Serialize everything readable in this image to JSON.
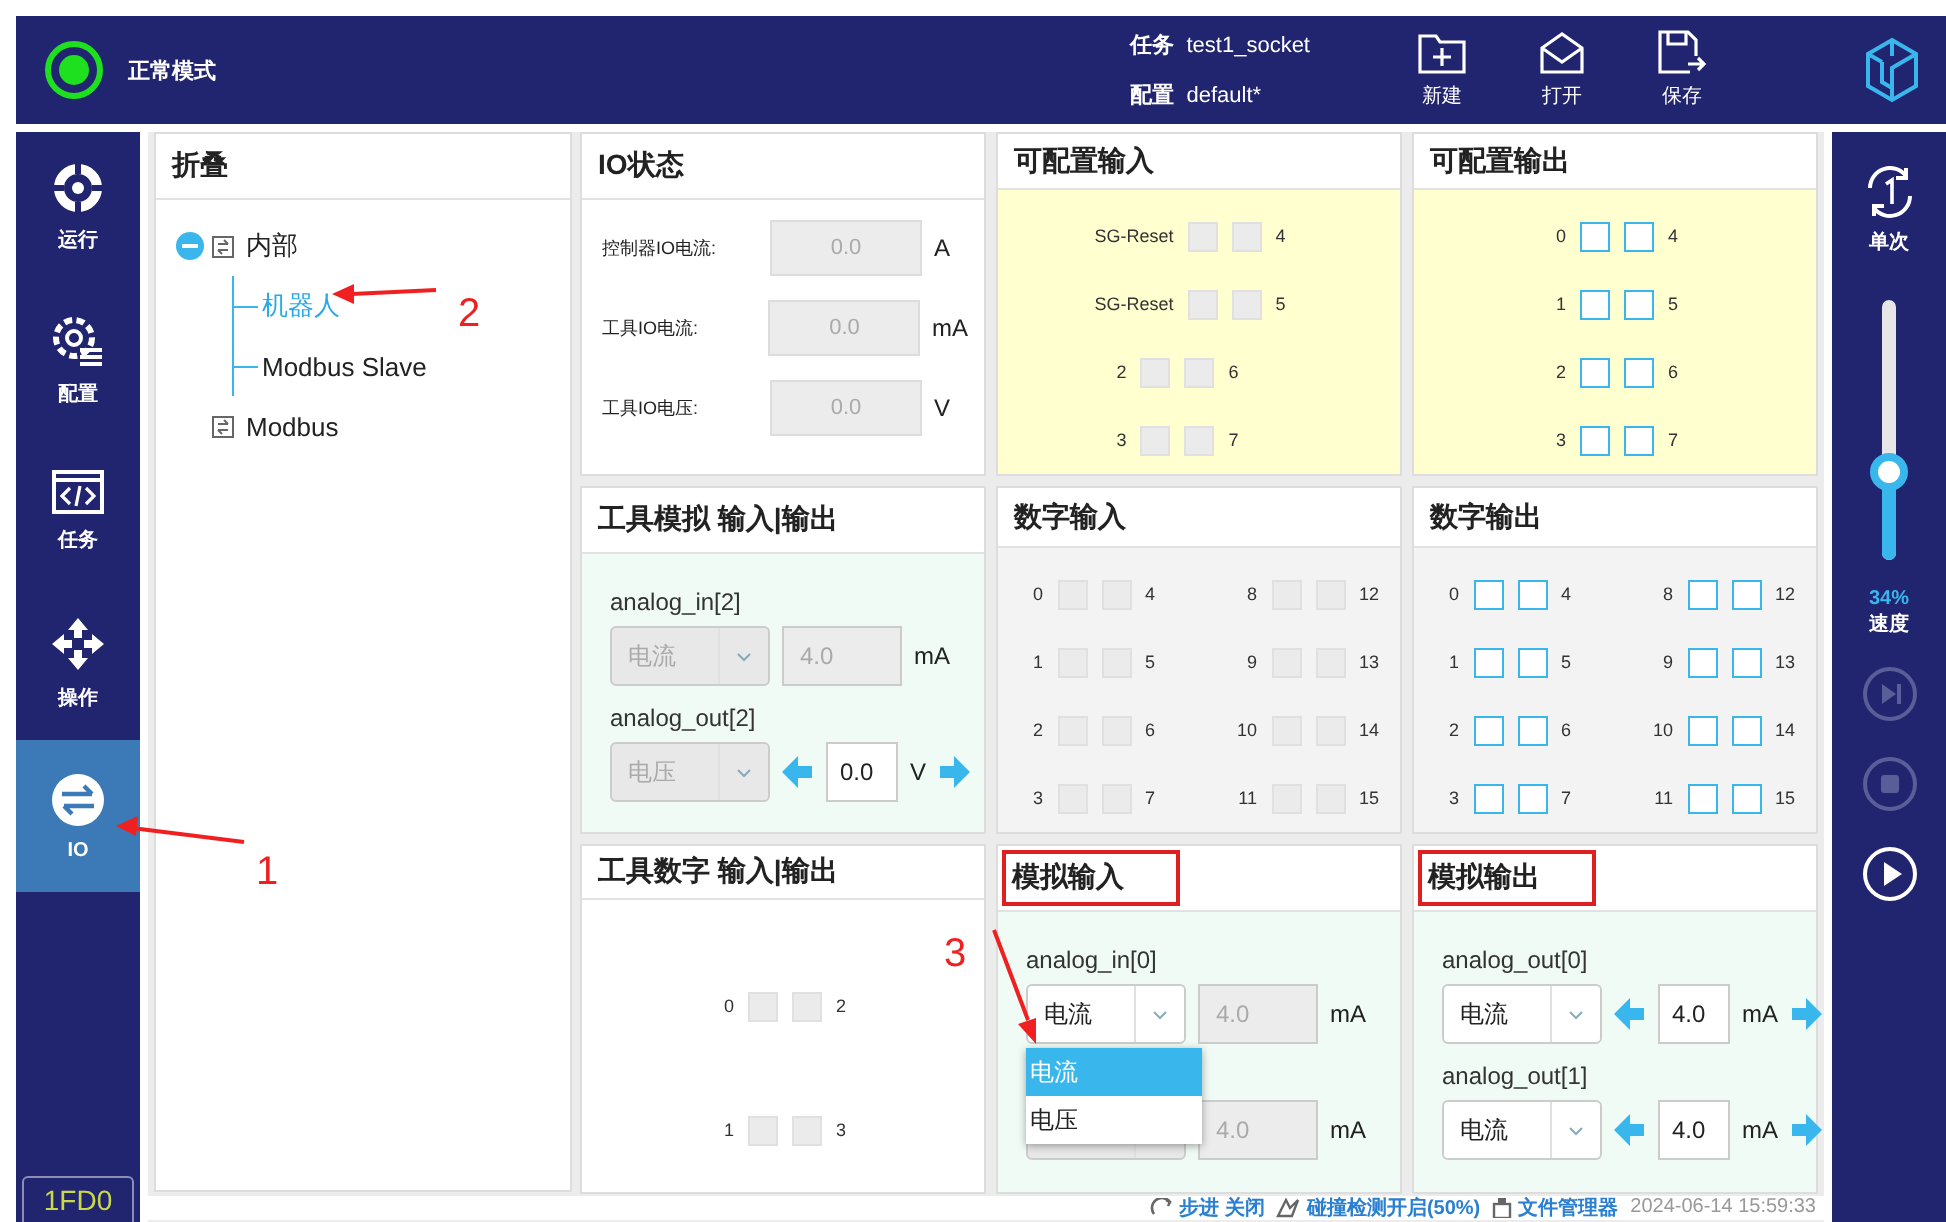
{
  "header": {
    "mode": "正常模式",
    "info": [
      {
        "label": "任务",
        "value": "test1_socket"
      },
      {
        "label": "配置",
        "value": "default*"
      }
    ],
    "actions": [
      {
        "label": "新建",
        "kind": "new"
      },
      {
        "label": "打开",
        "kind": "open"
      },
      {
        "label": "保存",
        "kind": "save"
      }
    ]
  },
  "nav": {
    "items": [
      {
        "label": "运行",
        "kind": "run",
        "selected": false
      },
      {
        "label": "配置",
        "kind": "config",
        "selected": false
      },
      {
        "label": "任务",
        "kind": "task",
        "selected": false
      },
      {
        "label": "操作",
        "kind": "move",
        "selected": false
      },
      {
        "label": "IO",
        "kind": "io",
        "selected": true
      }
    ],
    "badge": "1FD0"
  },
  "tree": {
    "title": "折叠",
    "items": [
      {
        "label": "内部",
        "expanded": true,
        "selected": false,
        "children": [
          {
            "label": "机器人",
            "selected": true
          },
          {
            "label": "Modbus Slave",
            "selected": false
          }
        ]
      },
      {
        "label": "Modbus",
        "expanded": false,
        "selected": false
      }
    ]
  },
  "panels": [
    {
      "kind": "status",
      "title": "IO状态",
      "highlighted": false,
      "rows": [
        {
          "label": "控制器IO电流:",
          "value": "0.0",
          "unit": "A"
        },
        {
          "label": "工具IO电流:",
          "value": "0.0",
          "unit": "mA"
        },
        {
          "label": "工具IO电压:",
          "value": "0.0",
          "unit": "V"
        }
      ]
    },
    {
      "kind": "config_in",
      "title": "可配置输入",
      "highlighted": false,
      "groups": [
        [
          {
            "a": "SG-Reset",
            "b": "4",
            "a_checked": false,
            "b_checked": false
          },
          {
            "a": "SG-Reset",
            "b": "5",
            "a_checked": false,
            "b_checked": false
          },
          {
            "a": "2",
            "b": "6",
            "a_checked": false,
            "b_checked": false
          },
          {
            "a": "3",
            "b": "7",
            "a_checked": false,
            "b_checked": false
          }
        ]
      ]
    },
    {
      "kind": "config_out",
      "title": "可配置输出",
      "highlighted": false,
      "groups": [
        [
          {
            "a": "0",
            "b": "4",
            "a_checked": false,
            "b_checked": false
          },
          {
            "a": "1",
            "b": "5",
            "a_checked": false,
            "b_checked": false
          },
          {
            "a": "2",
            "b": "6",
            "a_checked": false,
            "b_checked": false
          },
          {
            "a": "3",
            "b": "7",
            "a_checked": false,
            "b_checked": false
          }
        ]
      ]
    },
    {
      "kind": "tool_analog",
      "title": "工具模拟 输入|输出",
      "highlighted": false,
      "channels": [
        {
          "label": "analog_in[2]",
          "mode": "电流",
          "value": "4.0",
          "unit": "mA",
          "mode_disabled": true,
          "value_disabled": true,
          "stepper": false
        },
        {
          "label": "analog_out[2]",
          "mode": "电压",
          "value": "0.0",
          "unit": "V",
          "mode_disabled": true,
          "value_disabled": false,
          "stepper": true
        }
      ]
    },
    {
      "kind": "digital_in",
      "title": "数字输入",
      "highlighted": false,
      "groups": [
        [
          {
            "a": "0",
            "b": "4",
            "a_checked": false,
            "b_checked": false
          },
          {
            "a": "1",
            "b": "5",
            "a_checked": false,
            "b_checked": false
          },
          {
            "a": "2",
            "b": "6",
            "a_checked": false,
            "b_checked": false
          },
          {
            "a": "3",
            "b": "7",
            "a_checked": false,
            "b_checked": false
          }
        ],
        [
          {
            "a": "8",
            "b": "12",
            "a_checked": false,
            "b_checked": false
          },
          {
            "a": "9",
            "b": "13",
            "a_checked": false,
            "b_checked": false
          },
          {
            "a": "10",
            "b": "14",
            "a_checked": false,
            "b_checked": false
          },
          {
            "a": "11",
            "b": "15",
            "a_checked": false,
            "b_checked": false
          }
        ]
      ]
    },
    {
      "kind": "digital_out",
      "title": "数字输出",
      "highlighted": false,
      "groups": [
        [
          {
            "a": "0",
            "b": "4",
            "a_checked": false,
            "b_checked": false
          },
          {
            "a": "1",
            "b": "5",
            "a_checked": false,
            "b_checked": false
          },
          {
            "a": "2",
            "b": "6",
            "a_checked": false,
            "b_checked": false
          },
          {
            "a": "3",
            "b": "7",
            "a_checked": false,
            "b_checked": false
          }
        ],
        [
          {
            "a": "8",
            "b": "12",
            "a_checked": false,
            "b_checked": false
          },
          {
            "a": "9",
            "b": "13",
            "a_checked": false,
            "b_checked": false
          },
          {
            "a": "10",
            "b": "14",
            "a_checked": false,
            "b_checked": false
          },
          {
            "a": "11",
            "b": "15",
            "a_checked": false,
            "b_checked": false
          }
        ]
      ]
    },
    {
      "kind": "tool_digital",
      "title": "工具数字 输入|输出",
      "highlighted": false,
      "groups": [
        [
          {
            "a": "0",
            "b": "2",
            "a_checked": false,
            "b_checked": false
          },
          {
            "a": "1",
            "b": "3",
            "a_checked": false,
            "b_checked": false
          }
        ]
      ]
    },
    {
      "kind": "analog_in",
      "title": "模拟输入",
      "highlighted": true,
      "channels": [
        {
          "label": "analog_in[0]",
          "mode": "电流",
          "value": "4.0",
          "unit": "mA",
          "mode_disabled": false,
          "value_disabled": true,
          "stepper": false,
          "options": [
            {
              "label": "电流",
              "selected": true
            },
            {
              "label": "电压",
              "selected": false
            }
          ]
        },
        {
          "value": "4.0",
          "unit": "mA",
          "mode_disabled": true,
          "value_disabled": true,
          "stepper": false
        }
      ]
    },
    {
      "kind": "analog_out",
      "title": "模拟输出",
      "highlighted": true,
      "channels": [
        {
          "label": "analog_out[0]",
          "mode": "电流",
          "value": "4.0",
          "unit": "mA",
          "mode_disabled": false,
          "value_disabled": false,
          "stepper": true
        },
        {
          "label": "analog_out[1]",
          "mode": "电流",
          "value": "4.0",
          "unit": "mA",
          "mode_disabled": false,
          "value_disabled": false,
          "stepper": true
        }
      ]
    }
  ],
  "status_bar": [
    {
      "kind": "step",
      "label": "步进 关闭"
    },
    {
      "kind": "collision",
      "label": "碰撞检测开启(50%)"
    },
    {
      "kind": "files",
      "label": "文件管理器"
    },
    {
      "kind": "time",
      "label": "2024-06-14 15:59:33"
    }
  ],
  "rail": {
    "mode": "单次",
    "speed": {
      "level": 0.34,
      "reading": "34%",
      "label": "速度"
    },
    "controls": [
      {
        "kind": "step",
        "disabled": true
      },
      {
        "kind": "stop",
        "disabled": true
      },
      {
        "kind": "play",
        "disabled": false
      }
    ]
  },
  "annotations": [
    {
      "label": "1"
    },
    {
      "label": "2"
    },
    {
      "label": "3"
    }
  ]
}
